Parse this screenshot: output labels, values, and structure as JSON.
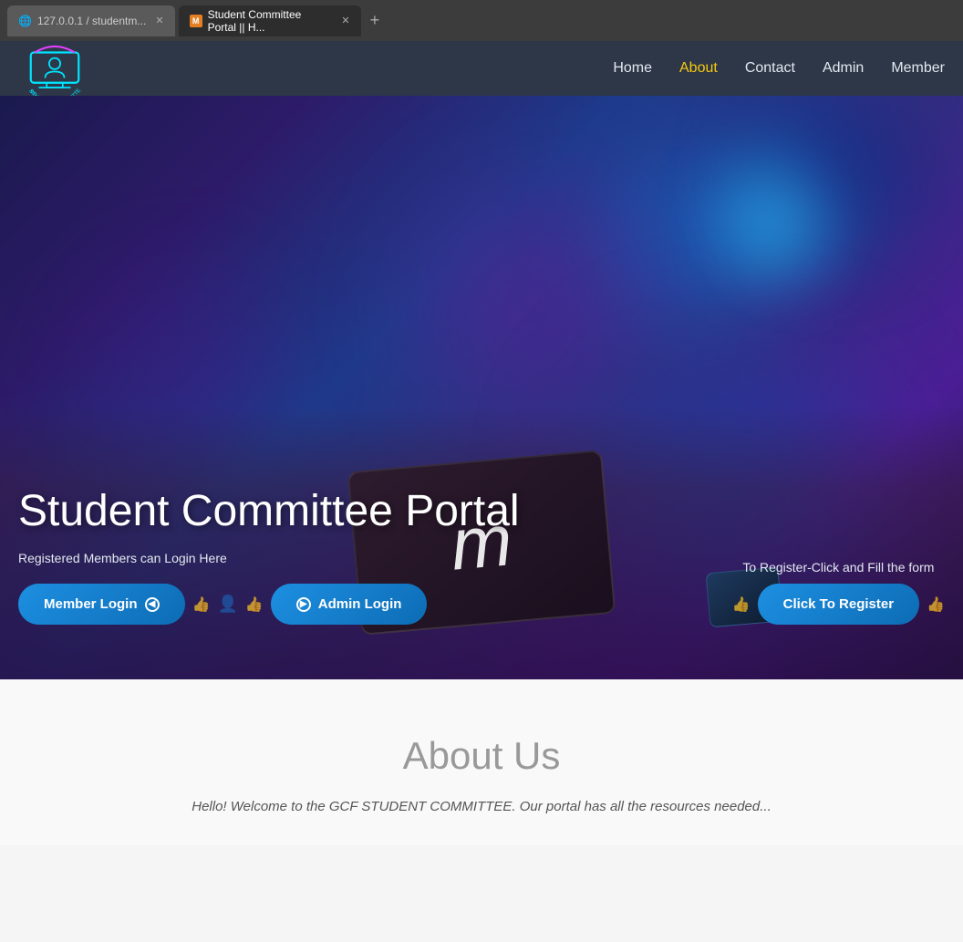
{
  "browser": {
    "tabs": [
      {
        "id": "tab1",
        "label": "127.0.0.1 / studentm...",
        "active": false,
        "icon": "🌐"
      },
      {
        "id": "tab2",
        "label": "Student Committee Portal || H...",
        "active": true,
        "icon": "M"
      }
    ],
    "new_tab_label": "+"
  },
  "navbar": {
    "logo_text": "STUDENTS COMMITTEE",
    "links": [
      {
        "label": "Home",
        "active": false
      },
      {
        "label": "About",
        "active": true
      },
      {
        "label": "Contact",
        "active": false
      },
      {
        "label": "Admin",
        "active": false
      },
      {
        "label": "Member",
        "active": false
      }
    ]
  },
  "hero": {
    "title": "Student Committee Portal",
    "member_subtitle": "Registered Members can Login Here",
    "register_subtitle": "To Register-Click and Fill the form",
    "member_login_label": "Member Login",
    "admin_login_label": "Admin Login",
    "register_label": "Click To Register"
  },
  "about": {
    "title": "About Us",
    "text": "Hello! Welcome to the GCF STUDENT COMMITTEE. Our portal has all the resources needed..."
  }
}
